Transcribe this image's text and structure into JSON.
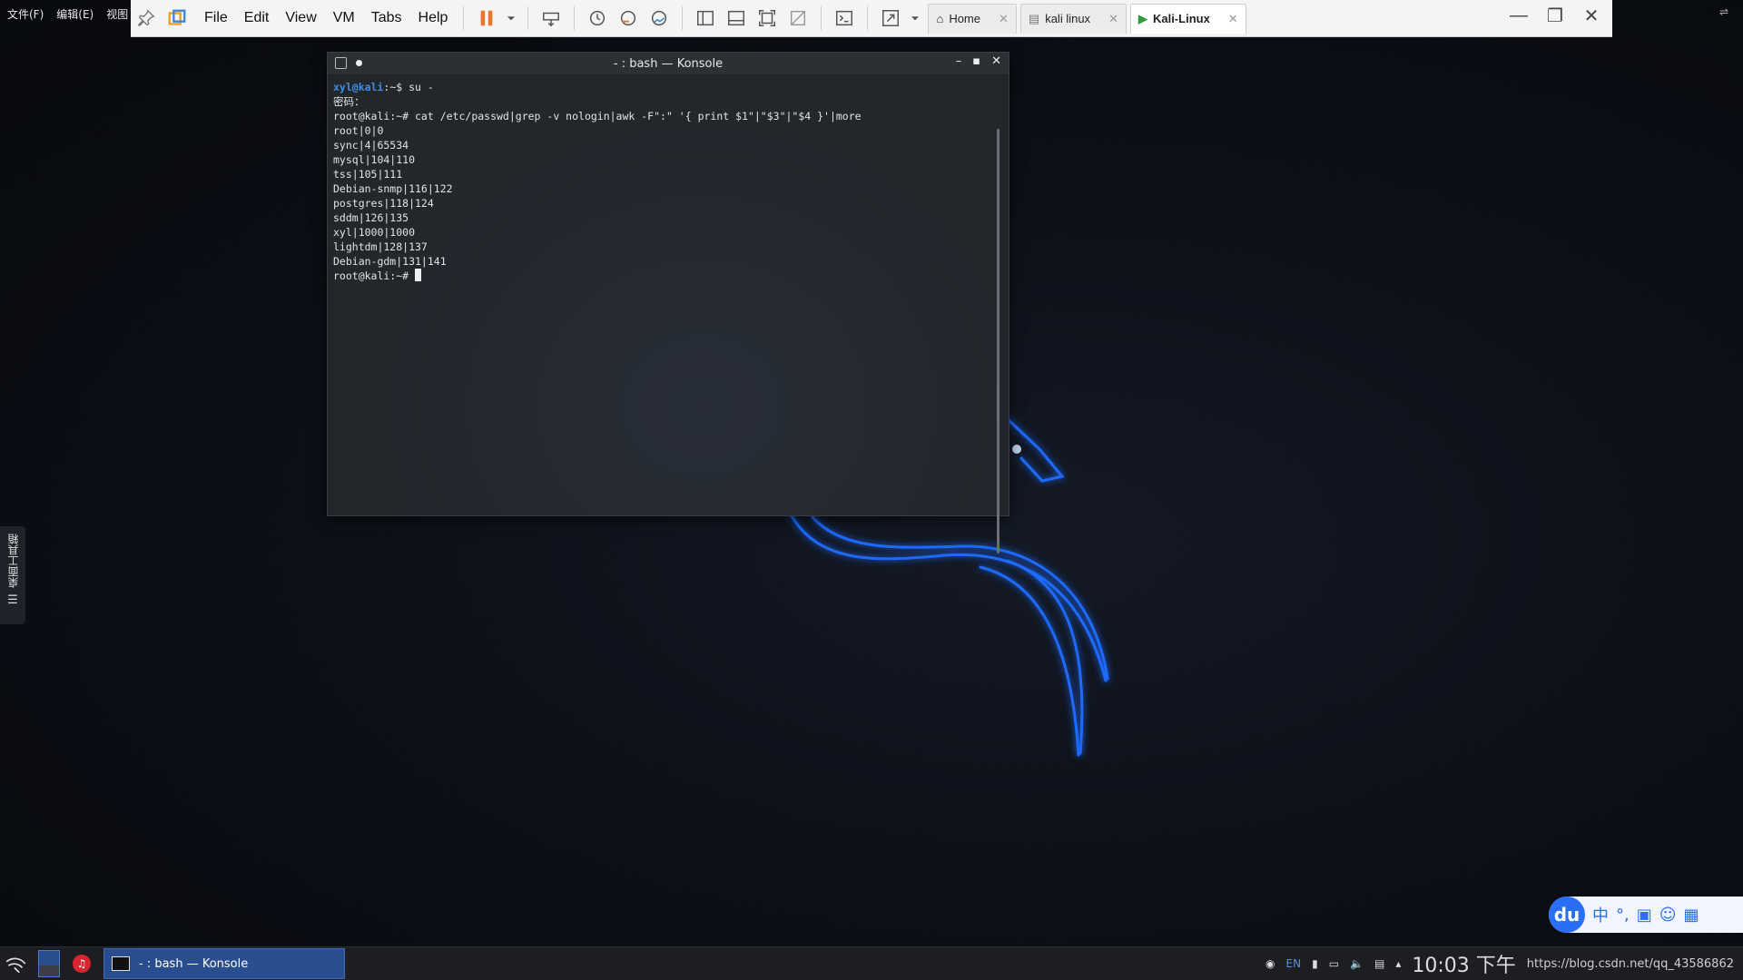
{
  "host_menu": {
    "items": [
      "文件(F)",
      "编辑(E)",
      "视图"
    ]
  },
  "vmware": {
    "menu": [
      "File",
      "Edit",
      "View",
      "VM",
      "Tabs",
      "Help"
    ],
    "tabs": [
      {
        "label": "Home",
        "icon": "home-icon"
      },
      {
        "label": "kali linux",
        "icon": "vm-icon"
      },
      {
        "label": "Kali-Linux",
        "icon": "vm-running-icon"
      }
    ],
    "accent_pause": "#e8752a"
  },
  "konsole": {
    "title": "- : bash — Konsole",
    "lines": [
      {
        "prompt_user": "xyl@kali",
        "prompt_rest": ":~$ su -"
      },
      {
        "text": "密码："
      },
      {
        "text": "root@kali:~# cat /etc/passwd|grep -v nologin|awk -F\":\" '{ print $1\"|\"$3\"|\"$4 }'|more"
      },
      {
        "text": "root|0|0"
      },
      {
        "text": "sync|4|65534"
      },
      {
        "text": "mysql|104|110"
      },
      {
        "text": "tss|105|111"
      },
      {
        "text": "Debian-snmp|116|122"
      },
      {
        "text": "postgres|118|124"
      },
      {
        "text": "sddm|126|135"
      },
      {
        "text": "xyl|1000|1000"
      },
      {
        "text": "lightdm|128|137"
      },
      {
        "text": "Debian-gdm|131|141"
      },
      {
        "text": "root@kali:~# "
      }
    ]
  },
  "side_tool": {
    "label": "桌面工具箱"
  },
  "ime": {
    "logo": "du",
    "items": [
      "中",
      "°,"
    ]
  },
  "taskbar": {
    "task_label": "- : bash — Konsole",
    "lang": "EN",
    "clock": "10:03 下午",
    "url_overlay": "https://blog.csdn.net/qq_43586862"
  }
}
